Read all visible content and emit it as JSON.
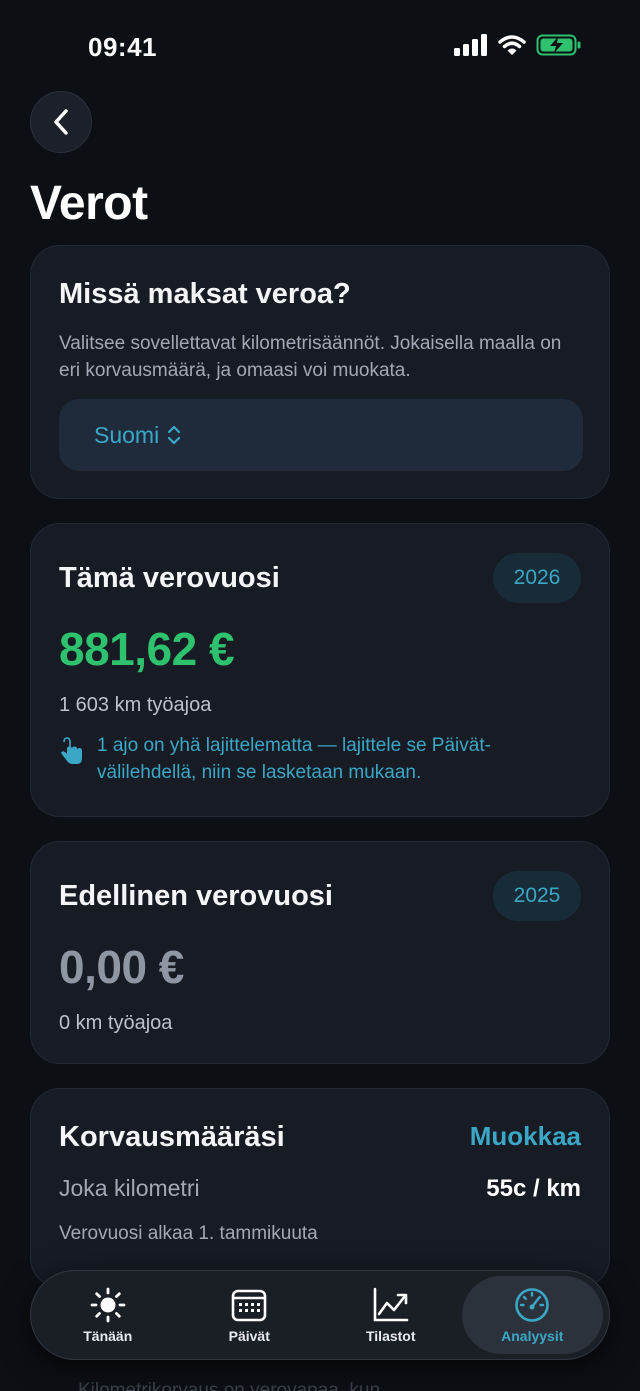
{
  "status_bar": {
    "time": "09:41"
  },
  "page": {
    "title": "Verot"
  },
  "country_card": {
    "title": "Missä maksat veroa?",
    "description": "Valitsee sovellettavat kilometrisäännöt. Jokaisella maalla on eri korvausmäärä, ja omaasi voi muokata.",
    "selected_country": "Suomi"
  },
  "current_year_card": {
    "title": "Tämä verovuosi",
    "year": "2026",
    "amount": "881,62 €",
    "km": "1 603 km työajoa",
    "notice": "1 ajo on yhä lajittelematta — lajittele se Päivät-välilehdellä, niin se lasketaan mukaan."
  },
  "previous_year_card": {
    "title": "Edellinen verovuosi",
    "year": "2025",
    "amount": "0,00 €",
    "km": "0 km työajoa"
  },
  "rate_card": {
    "title": "Korvausmääräsi",
    "edit_label": "Muokkaa",
    "rate_label": "Joka kilometri",
    "rate_value": "55c / km",
    "year_start": "Verovuosi alkaa 1. tammikuuta"
  },
  "bottom_obscured_text": "Kilometrikorvaus on verovapaa, kun...",
  "tabs": [
    {
      "label": "Tänään",
      "icon": "sun-icon",
      "active": false
    },
    {
      "label": "Päivät",
      "icon": "calendar-icon",
      "active": false
    },
    {
      "label": "Tilastot",
      "icon": "chart-icon",
      "active": false
    },
    {
      "label": "Analyysit",
      "icon": "speedometer-icon",
      "active": true
    }
  ],
  "colors": {
    "background": "#0c0f14",
    "card": "#161b24",
    "accent": "#3ba7c6",
    "positive": "#2fc26e",
    "muted_amount": "#8e96a3"
  }
}
